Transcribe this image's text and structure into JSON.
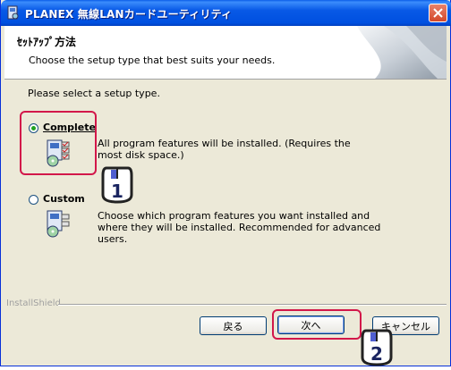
{
  "window": {
    "title": "PLANEX 無線LANカードユーティリティ"
  },
  "header": {
    "title": "ｾｯﾄｱｯﾌﾟ方法",
    "subtitle": "Choose the setup type that best suits your needs."
  },
  "body": {
    "prompt": "Please select a setup type.",
    "options": [
      {
        "label": "Complete",
        "selected": true,
        "description": "All program features will be installed. (Requires the most disk space.)"
      },
      {
        "label": "Custom",
        "selected": false,
        "description": "Choose which program features you want installed and where they will be installed. Recommended for advanced users."
      }
    ]
  },
  "footer": {
    "brand": "InstallShield",
    "buttons": {
      "back": "戻る",
      "next": "次へ",
      "cancel": "キャンセル"
    }
  },
  "annotations": {
    "step1": "1",
    "step2": "2",
    "highlight_color": "#d2174a"
  }
}
